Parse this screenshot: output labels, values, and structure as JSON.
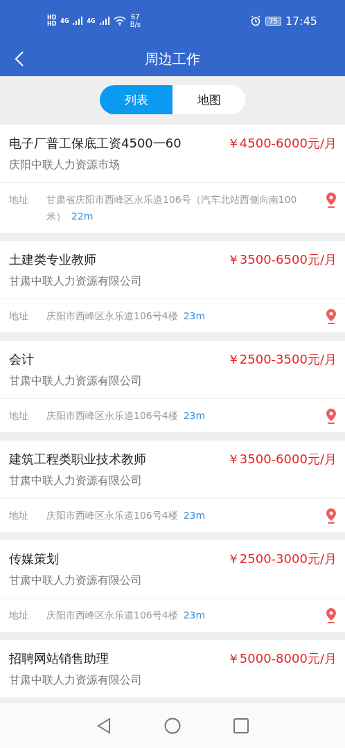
{
  "status_bar": {
    "sim_labels": [
      "HD",
      "HD"
    ],
    "network_labels": [
      "4G",
      "4G"
    ],
    "speed_value": "67",
    "speed_unit": "B/s",
    "battery": "75",
    "time": "17:45"
  },
  "header": {
    "title": "周边工作"
  },
  "tabs": [
    {
      "label": "列表",
      "selected": true
    },
    {
      "label": "地图",
      "selected": false
    }
  ],
  "jobs": [
    {
      "title": "电子厂普工保底工资4500一60",
      "salary": "￥4500-6000元/月",
      "company": "庆阳中联人力资源市场",
      "address_label": "地址",
      "address": "甘肃省庆阳市西峰区永乐道106号（汽车北站西侧向南100米）",
      "distance": "22m"
    },
    {
      "title": "土建类专业教师",
      "salary": "￥3500-6500元/月",
      "company": "甘肃中联人力资源有限公司",
      "address_label": "地址",
      "address": "庆阳市西峰区永乐道106号4楼",
      "distance": "23m"
    },
    {
      "title": "会计",
      "salary": "￥2500-3500元/月",
      "company": "甘肃中联人力资源有限公司",
      "address_label": "地址",
      "address": "庆阳市西峰区永乐道106号4楼",
      "distance": "23m"
    },
    {
      "title": "建筑工程类职业技术教师",
      "salary": "￥3500-6000元/月",
      "company": "甘肃中联人力资源有限公司",
      "address_label": "地址",
      "address": "庆阳市西峰区永乐道106号4楼",
      "distance": "23m"
    },
    {
      "title": "传媒策划",
      "salary": "￥2500-3000元/月",
      "company": "甘肃中联人力资源有限公司",
      "address_label": "地址",
      "address": "庆阳市西峰区永乐道106号4楼",
      "distance": "23m"
    },
    {
      "title": "招聘网站销售助理",
      "salary": "￥5000-8000元/月",
      "company": "甘肃中联人力资源有限公司"
    }
  ]
}
